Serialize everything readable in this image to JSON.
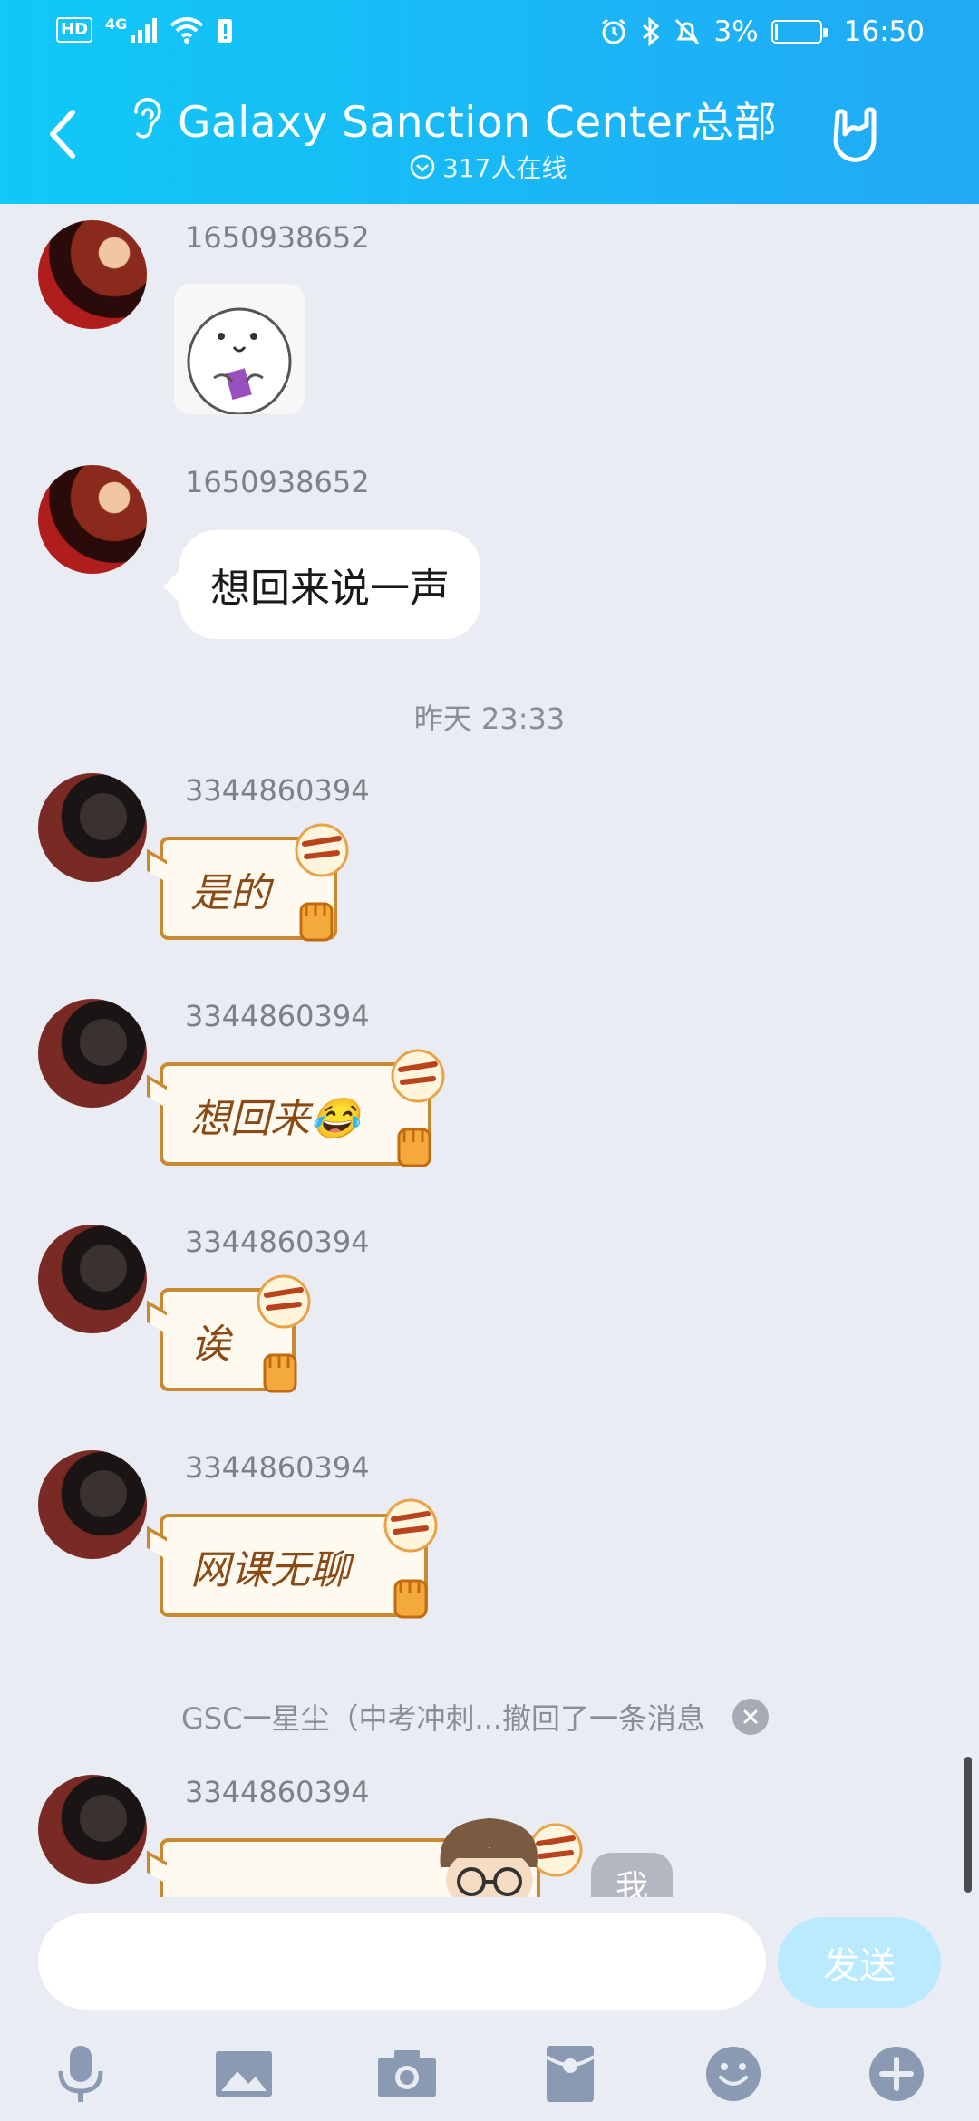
{
  "status_bar": {
    "network": "4G",
    "hd": "HD",
    "battery": "3%",
    "time": "16:50"
  },
  "header": {
    "title": "Galaxy Sanction Center总部",
    "online": "317人在线"
  },
  "messages": [
    {
      "sender": "1650938652",
      "type": "sticker"
    },
    {
      "sender": "1650938652",
      "type": "text",
      "text": "想回来说一声"
    },
    {
      "timestamp": "昨天 23:33"
    },
    {
      "sender": "3344860394",
      "type": "deco",
      "text": "是的"
    },
    {
      "sender": "3344860394",
      "type": "deco",
      "text": "想回来😂"
    },
    {
      "sender": "3344860394",
      "type": "deco",
      "text": "诶"
    },
    {
      "sender": "3344860394",
      "type": "deco",
      "text": "网课无聊"
    },
    {
      "recall": "GSC一星尘（中考冲刺...撤回了一条消息"
    },
    {
      "sender": "3344860394",
      "type": "deco",
      "text": ""
    }
  ],
  "me_label": "我",
  "input": {
    "placeholder": "",
    "send": "发送"
  },
  "toolbar": {
    "icons": [
      "microphone-icon",
      "image-icon",
      "camera-icon",
      "red-packet-icon",
      "emoji-icon",
      "plus-icon"
    ]
  },
  "colors": {
    "header_start": "#10c9f7",
    "header_end": "#21a9f5",
    "background": "#eaecf3",
    "send_button": "#b9eaff",
    "deco_border": "#c8892f"
  }
}
